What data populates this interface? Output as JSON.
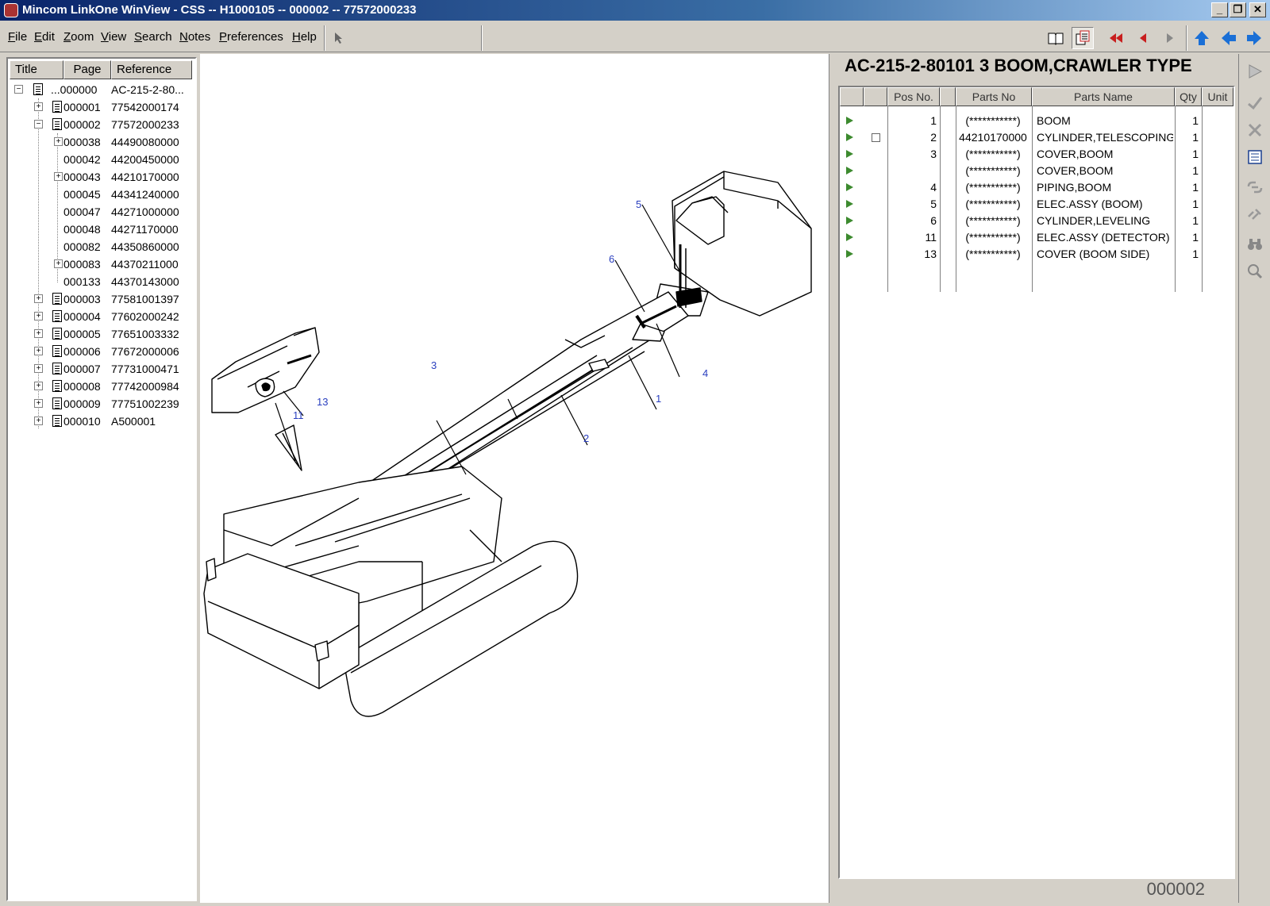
{
  "window": {
    "title": "Mincom LinkOne WinView - CSS -- H1000105 -- 000002 -- 77572000233",
    "minimize": "_",
    "restore": "❐",
    "close": "✕"
  },
  "menu": {
    "items": [
      {
        "label": "File",
        "underline": "F",
        "rest": "ile"
      },
      {
        "label": "Edit",
        "underline": "E",
        "rest": "dit"
      },
      {
        "label": "Zoom",
        "underline": "Z",
        "rest": "oom"
      },
      {
        "label": "View",
        "underline": "V",
        "rest": "iew"
      },
      {
        "label": "Search",
        "underline": "S",
        "rest": "earch"
      },
      {
        "label": "Notes",
        "underline": "N",
        "rest": "otes"
      },
      {
        "label": "Preferences",
        "underline": "P",
        "rest": "references"
      },
      {
        "label": "Help",
        "underline": "H",
        "rest": "elp"
      }
    ]
  },
  "toolbar": {
    "icons": [
      "pointer-icon",
      "book-icon",
      "list-view-icon",
      "first-icon",
      "prev-icon",
      "next-icon",
      "up-icon",
      "back-icon",
      "forward-icon"
    ]
  },
  "tree": {
    "headers": {
      "title": "Title",
      "page": "Page",
      "reference": "Reference"
    },
    "rows": [
      {
        "page": "...000000",
        "ref": "AC-215-2-80...",
        "level": 0,
        "expander": "−",
        "doc": true
      },
      {
        "page": "000001",
        "ref": "77542000174",
        "level": 1,
        "expander": "+",
        "doc": true
      },
      {
        "page": "000002",
        "ref": "77572000233",
        "level": 1,
        "expander": "−",
        "doc": true
      },
      {
        "page": "000038",
        "ref": "44490080000",
        "level": 2,
        "expander": "+",
        "doc": false
      },
      {
        "page": "000042",
        "ref": "44200450000",
        "level": 2,
        "expander": "",
        "doc": false
      },
      {
        "page": "000043",
        "ref": "44210170000",
        "level": 2,
        "expander": "+",
        "doc": false
      },
      {
        "page": "000045",
        "ref": "44341240000",
        "level": 2,
        "expander": "",
        "doc": false
      },
      {
        "page": "000047",
        "ref": "44271000000",
        "level": 2,
        "expander": "",
        "doc": false
      },
      {
        "page": "000048",
        "ref": "44271170000",
        "level": 2,
        "expander": "",
        "doc": false
      },
      {
        "page": "000082",
        "ref": "44350860000",
        "level": 2,
        "expander": "",
        "doc": false
      },
      {
        "page": "000083",
        "ref": "44370211000",
        "level": 2,
        "expander": "+",
        "doc": false
      },
      {
        "page": "000133",
        "ref": "44370143000",
        "level": 2,
        "expander": "",
        "doc": false
      },
      {
        "page": "000003",
        "ref": "77581001397",
        "level": 1,
        "expander": "+",
        "doc": true
      },
      {
        "page": "000004",
        "ref": "77602000242",
        "level": 1,
        "expander": "+",
        "doc": true
      },
      {
        "page": "000005",
        "ref": "77651003332",
        "level": 1,
        "expander": "+",
        "doc": true
      },
      {
        "page": "000006",
        "ref": "77672000006",
        "level": 1,
        "expander": "+",
        "doc": true
      },
      {
        "page": "000007",
        "ref": "77731000471",
        "level": 1,
        "expander": "+",
        "doc": true
      },
      {
        "page": "000008",
        "ref": "77742000984",
        "level": 1,
        "expander": "+",
        "doc": true
      },
      {
        "page": "000009",
        "ref": "77751002239",
        "level": 1,
        "expander": "+",
        "doc": true
      },
      {
        "page": "000010",
        "ref": "A500001",
        "level": 1,
        "expander": "+",
        "doc": true
      }
    ]
  },
  "drawing": {
    "callouts": [
      "1",
      "2",
      "3",
      "4",
      "5",
      "6",
      "11",
      "13"
    ]
  },
  "parts": {
    "title": "AC-215-2-80101 3 BOOM,CRAWLER TYPE",
    "headers": {
      "pos": "Pos No.",
      "partno": "Parts No",
      "name": "Parts Name",
      "qty": "Qty",
      "unit": "Unit"
    },
    "rows": [
      {
        "pos": "1",
        "partno": "(***********)",
        "name": "BOOM",
        "qty": "1",
        "check": false
      },
      {
        "pos": "2",
        "partno": "44210170000",
        "name": "CYLINDER,TELESCOPING",
        "qty": "1",
        "check": true
      },
      {
        "pos": "3",
        "partno": "(***********)",
        "name": "COVER,BOOM",
        "qty": "1",
        "check": false
      },
      {
        "pos": "",
        "partno": "(***********)",
        "name": "COVER,BOOM",
        "qty": "1",
        "check": false
      },
      {
        "pos": "4",
        "partno": "(***********)",
        "name": "PIPING,BOOM",
        "qty": "1",
        "check": false
      },
      {
        "pos": "5",
        "partno": "(***********)",
        "name": "ELEC.ASSY (BOOM)",
        "qty": "1",
        "check": false
      },
      {
        "pos": "6",
        "partno": "(***********)",
        "name": "CYLINDER,LEVELING",
        "qty": "1",
        "check": false
      },
      {
        "pos": "11",
        "partno": "(***********)",
        "name": "ELEC.ASSY (DETECTOR)",
        "qty": "1",
        "check": false
      },
      {
        "pos": "13",
        "partno": "(***********)",
        "name": "COVER (BOOM SIDE)",
        "qty": "1",
        "check": false
      }
    ],
    "page_id": "000002"
  },
  "side_toolbar": {
    "icons": [
      "play-icon",
      "check-icon",
      "cross-icon",
      "list-icon",
      "link-icon",
      "unlink-icon",
      "binoculars-icon",
      "zoom-icon"
    ]
  },
  "colors": {
    "titlebar_start": "#0a246a",
    "accent_blue": "#1a6fd6",
    "accent_red": "#c81e1e",
    "row_arrow": "#3c8a2e",
    "callout": "#2a3fbf"
  }
}
